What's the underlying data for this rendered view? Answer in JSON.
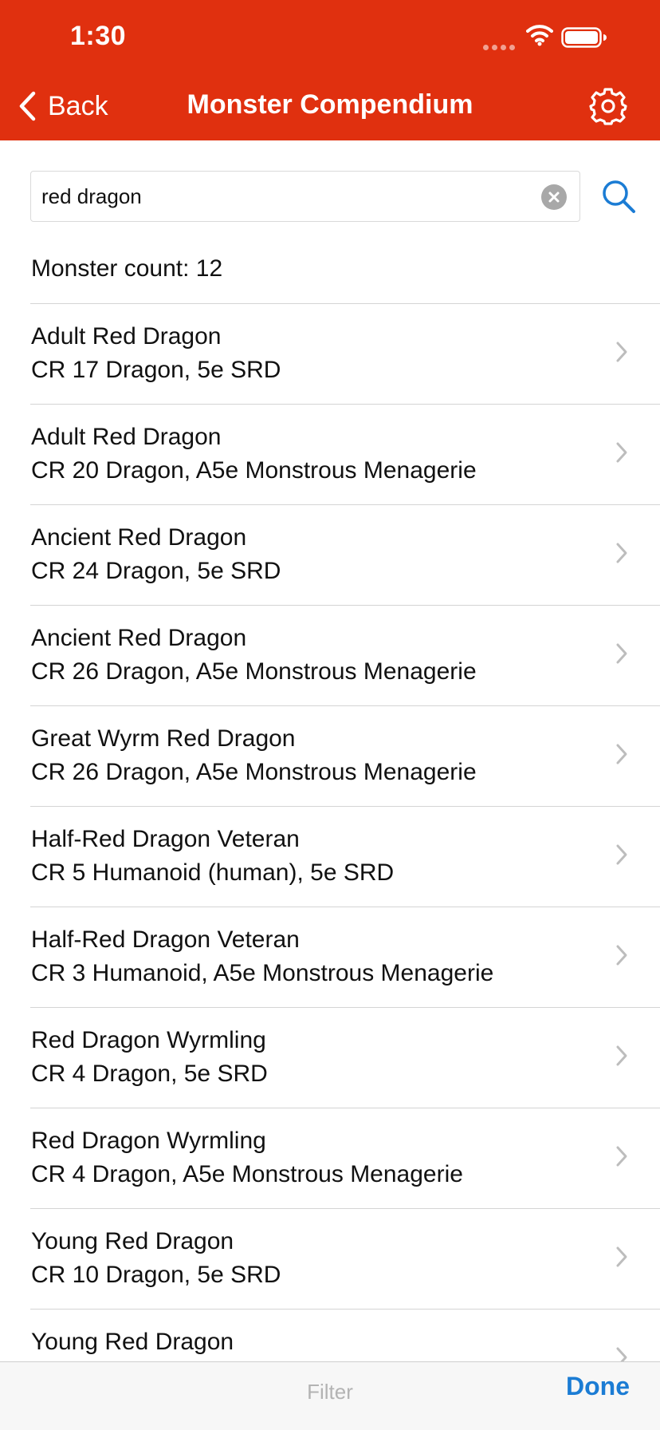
{
  "status_bar": {
    "time": "1:30"
  },
  "nav": {
    "back_label": "Back",
    "title": "Monster Compendium"
  },
  "search": {
    "value": "red dragon"
  },
  "results": {
    "count_label": "Monster count: 12",
    "items": [
      {
        "name": "Adult Red Dragon",
        "detail": "CR 17 Dragon, 5e SRD"
      },
      {
        "name": "Adult Red Dragon",
        "detail": "CR 20 Dragon, A5e Monstrous Menagerie"
      },
      {
        "name": "Ancient Red Dragon",
        "detail": "CR 24 Dragon, 5e SRD"
      },
      {
        "name": "Ancient Red Dragon",
        "detail": "CR 26 Dragon, A5e Monstrous Menagerie"
      },
      {
        "name": "Great Wyrm Red Dragon",
        "detail": "CR 26 Dragon, A5e Monstrous Menagerie"
      },
      {
        "name": "Half-Red Dragon Veteran",
        "detail": "CR 5 Humanoid (human), 5e SRD"
      },
      {
        "name": "Half-Red Dragon Veteran",
        "detail": "CR 3 Humanoid, A5e Monstrous Menagerie"
      },
      {
        "name": "Red Dragon Wyrmling",
        "detail": "CR 4 Dragon, 5e SRD"
      },
      {
        "name": "Red Dragon Wyrmling",
        "detail": "CR 4 Dragon, A5e Monstrous Menagerie"
      },
      {
        "name": "Young Red Dragon",
        "detail": "CR 10 Dragon, 5e SRD"
      },
      {
        "name": "Young Red Dragon",
        "detail": ""
      }
    ]
  },
  "toolbar": {
    "filter_label": "Filter",
    "done_label": "Done"
  },
  "colors": {
    "header_bg": "#e0300f",
    "accent_blue": "#1b7cd4"
  },
  "icons": {
    "back": "chevron-left-icon",
    "settings": "gear-icon",
    "clear": "clear-circle-icon",
    "search": "search-icon",
    "row": "chevron-right-icon",
    "wifi": "wifi-icon",
    "battery": "battery-icon"
  }
}
